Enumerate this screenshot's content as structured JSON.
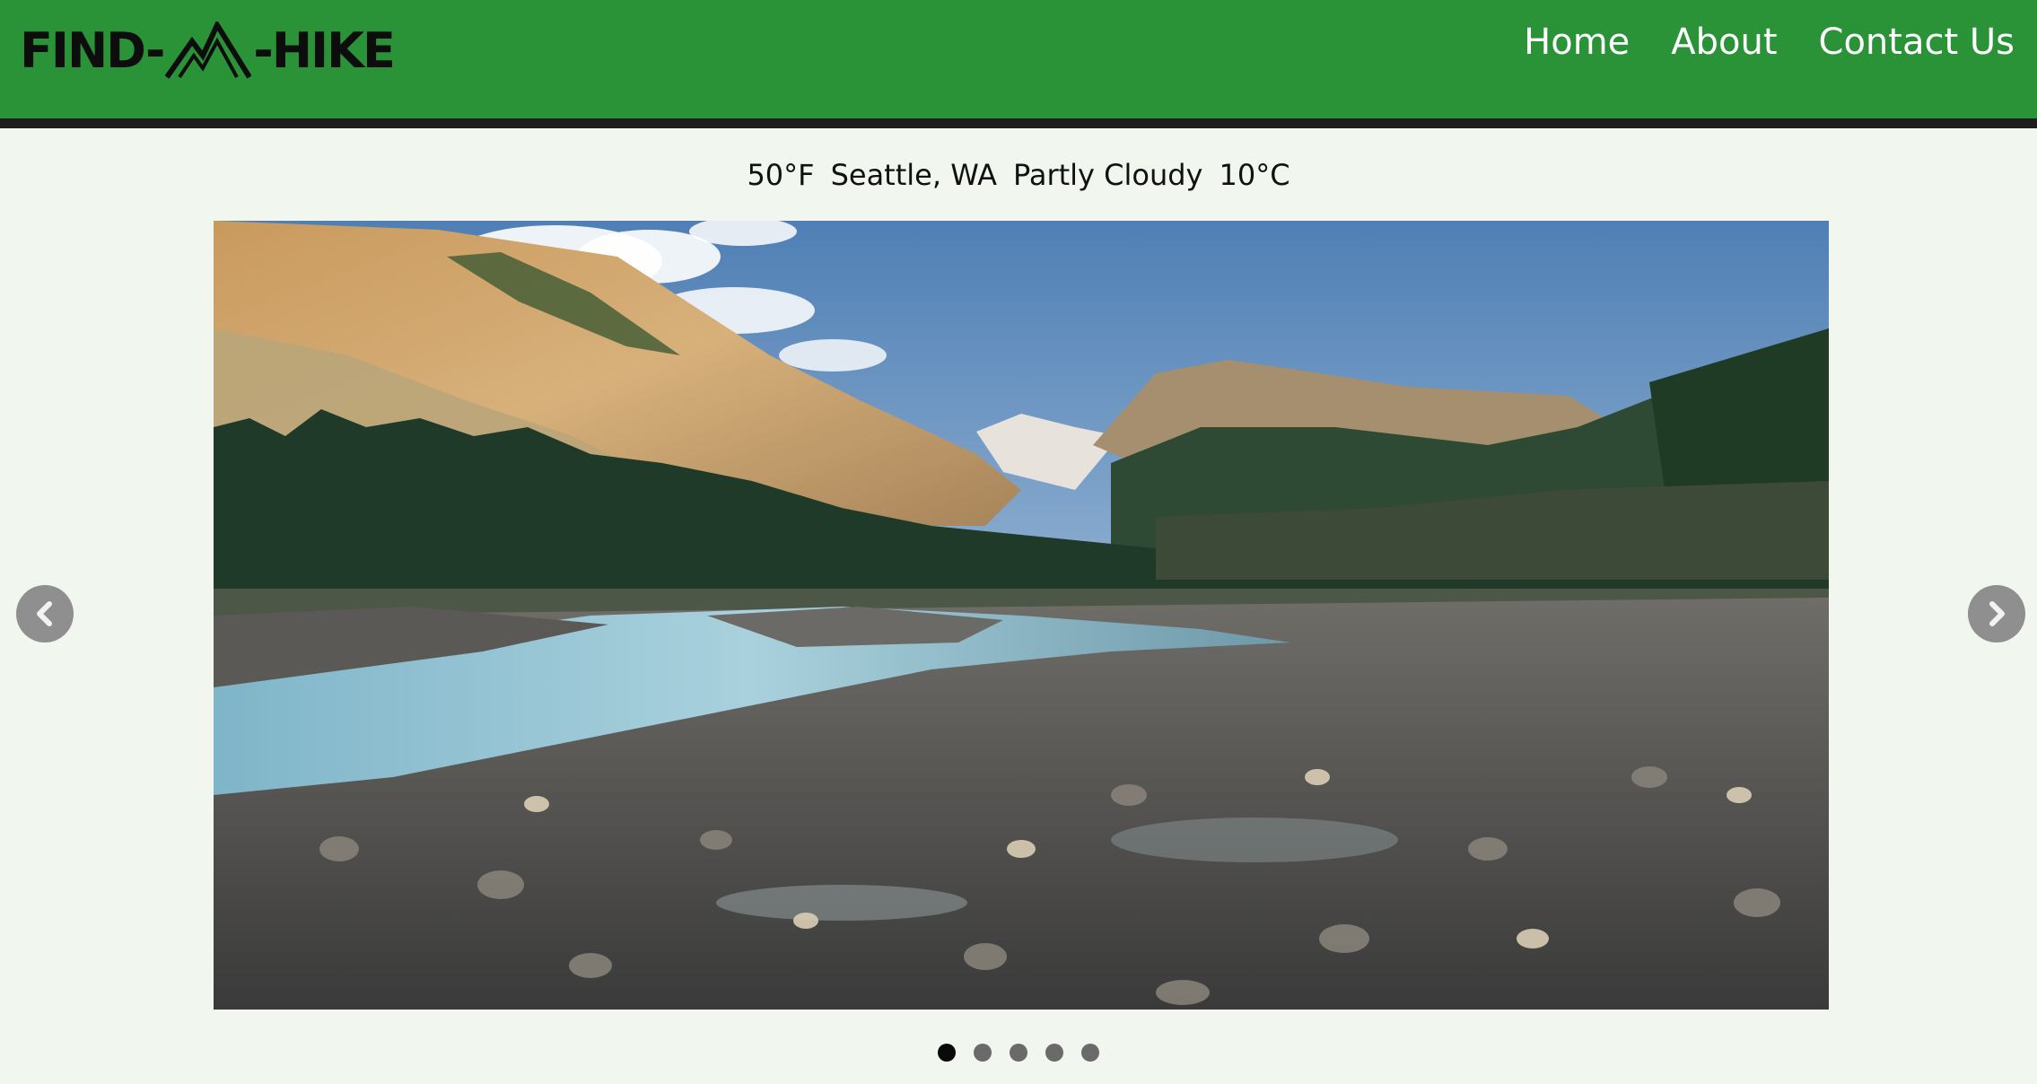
{
  "brand": {
    "logo_left": "FIND-",
    "logo_right": "-HIKE",
    "logo_icon": "mountain-icon",
    "primary_color": "#2a9338",
    "border_color": "#1d1d1d",
    "background_color": "#f1f7ee"
  },
  "nav": {
    "links": [
      {
        "label": "Home"
      },
      {
        "label": "About"
      },
      {
        "label": "Contact Us"
      }
    ]
  },
  "weather": {
    "temp_f": "50°F",
    "location": "Seattle, WA",
    "condition": "Partly Cloudy",
    "temp_c": "10°C"
  },
  "carousel": {
    "prev_icon": "chevron-left-icon",
    "next_icon": "chevron-right-icon",
    "slide_count": 5,
    "active_index": 0
  }
}
